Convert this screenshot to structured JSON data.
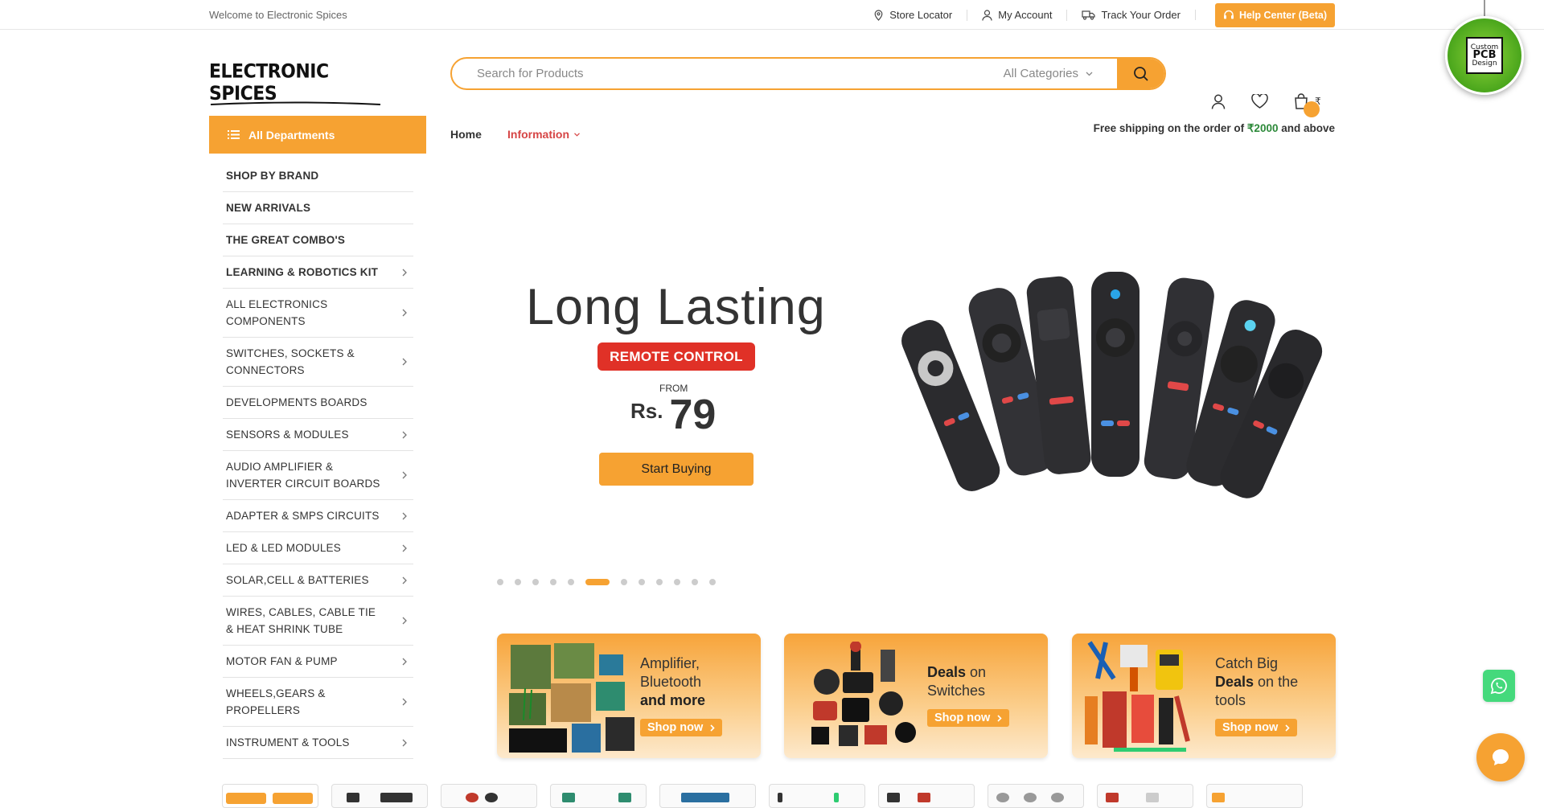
{
  "topbar": {
    "welcome": "Welcome to Electronic Spices",
    "store_locator": "Store Locator",
    "my_account": "My Account",
    "track_order": "Track Your Order",
    "help_center": "Help Center (Beta)"
  },
  "header": {
    "logo_text": "ELECTRONIC SPICES",
    "search_placeholder": "Search for Products",
    "category_select": "All Categories",
    "currency_symbol": "₹",
    "icons": [
      "user-icon",
      "heart-icon",
      "cart-icon"
    ]
  },
  "pcb_badge": {
    "line1": "Custom",
    "line2": "PCB",
    "line3": "Design"
  },
  "nav": {
    "all_departments": "All Departments",
    "home": "Home",
    "information": "Information",
    "free_shipping_prefix": "Free shipping on the order of ",
    "free_shipping_amount": "₹2000",
    "free_shipping_suffix": " and above"
  },
  "sidebar": {
    "items": [
      {
        "label": "SHOP BY BRAND",
        "bold": true,
        "arrow": false
      },
      {
        "label": "NEW ARRIVALS",
        "bold": true,
        "arrow": false
      },
      {
        "label": "THE GREAT COMBO'S",
        "bold": true,
        "arrow": false
      },
      {
        "label": "LEARNING & ROBOTICS KIT",
        "bold": true,
        "arrow": true
      },
      {
        "label": "ALL ELECTRONICS COMPONENTS",
        "bold": false,
        "arrow": true
      },
      {
        "label": "SWITCHES, SOCKETS & CONNECTORS",
        "bold": false,
        "arrow": true
      },
      {
        "label": "DEVELOPMENTS BOARDS",
        "bold": false,
        "arrow": false
      },
      {
        "label": "SENSORS & MODULES",
        "bold": false,
        "arrow": true
      },
      {
        "label": "AUDIO AMPLIFIER & INVERTER CIRCUIT BOARDS",
        "bold": false,
        "arrow": true
      },
      {
        "label": "ADAPTER & SMPS CIRCUITS",
        "bold": false,
        "arrow": true
      },
      {
        "label": "LED & LED MODULES",
        "bold": false,
        "arrow": true
      },
      {
        "label": "SOLAR,CELL & BATTERIES",
        "bold": false,
        "arrow": true
      },
      {
        "label": "WIRES, CABLES, CABLE TIE & HEAT SHRINK TUBE",
        "bold": false,
        "arrow": true
      },
      {
        "label": "MOTOR FAN & PUMP",
        "bold": false,
        "arrow": true
      },
      {
        "label": "WHEELS,GEARS & PROPELLERS",
        "bold": false,
        "arrow": true
      },
      {
        "label": "INSTRUMENT & TOOLS",
        "bold": false,
        "arrow": true
      }
    ]
  },
  "hero": {
    "title": "Long Lasting",
    "badge": "REMOTE CONTROL",
    "from_label": "FROM",
    "currency": "Rs.",
    "price": "79",
    "button": "Start Buying",
    "slide_count": 12,
    "active_slide": 6
  },
  "promos": [
    {
      "line1": "Amplifier,",
      "line2": "Bluetooth",
      "line3_bold": "and more",
      "button": "Shop now"
    },
    {
      "bold1": "Deals",
      "text1": " on",
      "line2": "Switches",
      "button": "Shop now"
    },
    {
      "line1": "Catch Big",
      "bold2": "Deals",
      "text2": " on the",
      "line3": "tools",
      "button": "Shop now"
    }
  ],
  "colors": {
    "accent": "#f6a232",
    "red_badge": "#e03127",
    "info_link": "#d64545",
    "ship_amount": "#2d8a3a"
  }
}
